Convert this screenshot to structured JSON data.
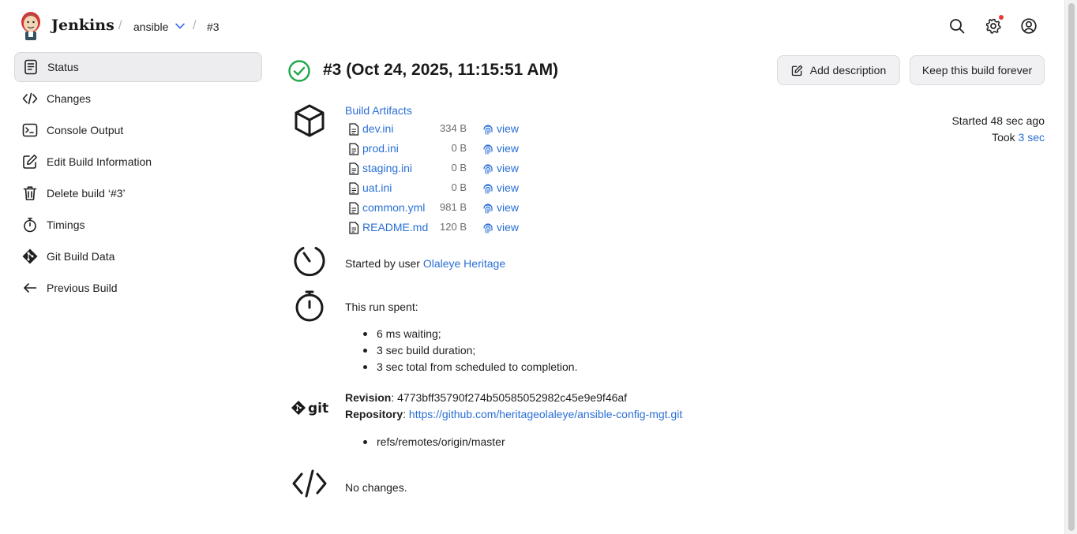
{
  "header": {
    "brand": "Jenkins",
    "breadcrumb": [
      {
        "label": "ansible"
      },
      {
        "label": "#3"
      }
    ],
    "icons": [
      "search-icon",
      "gear-icon",
      "user-icon"
    ],
    "notification_color": "#e63a3a"
  },
  "sidebar": {
    "items": [
      {
        "label": "Status",
        "icon": "document-icon",
        "active": true
      },
      {
        "label": "Changes",
        "icon": "code-icon"
      },
      {
        "label": "Console Output",
        "icon": "terminal-icon"
      },
      {
        "label": "Edit Build Information",
        "icon": "edit-icon"
      },
      {
        "label": "Delete build ‘#3’",
        "icon": "trash-icon"
      },
      {
        "label": "Timings",
        "icon": "timer-icon"
      },
      {
        "label": "Git Build Data",
        "icon": "git-icon"
      },
      {
        "label": "Previous Build",
        "icon": "arrow-left-icon"
      }
    ]
  },
  "build": {
    "title": "#3 (Oct 24, 2025, 11:15:51 AM)",
    "status_color": "#1ea64a",
    "add_description": "Add description",
    "keep_forever": "Keep this build forever",
    "started_ago": "Started 48 sec ago",
    "took_prefix": "Took",
    "took_value": "3 sec"
  },
  "artifacts": {
    "title": "Build Artifacts",
    "view_label": "view",
    "files": [
      {
        "name": "dev.ini",
        "size": "334 B"
      },
      {
        "name": "prod.ini",
        "size": "0 B"
      },
      {
        "name": "staging.ini",
        "size": "0 B"
      },
      {
        "name": "uat.ini",
        "size": "0 B"
      },
      {
        "name": "common.yml",
        "size": "981 B"
      },
      {
        "name": "README.md",
        "size": "120 B"
      }
    ]
  },
  "cause": {
    "prefix": "Started by user",
    "user": "Olaleye Heritage"
  },
  "timing": {
    "title": "This run spent:",
    "items": [
      "6 ms waiting;",
      "3 sec build duration;",
      "3 sec total from scheduled to completion."
    ]
  },
  "git": {
    "logo_text": "git",
    "revision_label": "Revision",
    "revision": "4773bff35790f274b50585052982c45e9e9f46af",
    "repository_label": "Repository",
    "repository": "https://github.com/heritageolaleye/ansible-config-mgt.git",
    "branches": [
      "refs/remotes/origin/master"
    ]
  },
  "changes": {
    "text": "No changes."
  }
}
